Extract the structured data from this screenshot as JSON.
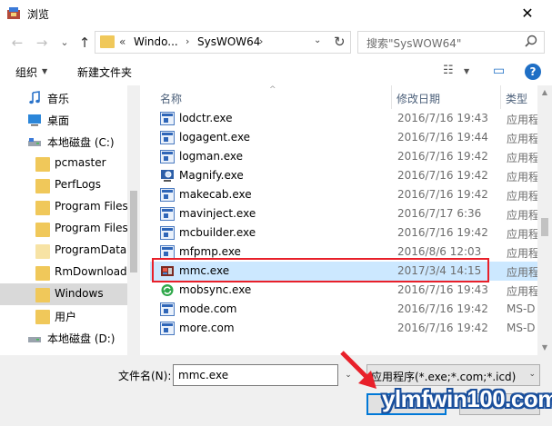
{
  "window": {
    "title": "浏览",
    "close_glyph": "✕"
  },
  "nav": {
    "back_glyph": "←",
    "forward_glyph": "→",
    "recent_glyph": "⌄",
    "up_glyph": "↑",
    "breadcrumb_overflow": "«",
    "breadcrumb": [
      "Windo...",
      "SysWOW64"
    ],
    "separator_glyph": "›",
    "dropdown_glyph": "⌄",
    "refresh_glyph": "↻",
    "search_placeholder": "搜索\"SysWOW64\""
  },
  "toolbar": {
    "organize_label": "组织",
    "organize_caret": "▼",
    "new_folder_label": "新建文件夹",
    "view_glyph": "☷",
    "view_caret": "▼",
    "preview_glyph": "▭",
    "help_glyph": "?"
  },
  "sidebar": {
    "items": [
      {
        "label": "音乐",
        "icon": "music-icon"
      },
      {
        "label": "桌面",
        "icon": "desktop-icon"
      },
      {
        "label": "本地磁盘 (C:)",
        "icon": "drive-icon"
      },
      {
        "label": "pcmaster",
        "icon": "folder-icon"
      },
      {
        "label": "PerfLogs",
        "icon": "folder-icon"
      },
      {
        "label": "Program Files",
        "icon": "folder-icon"
      },
      {
        "label": "Program Files",
        "icon": "folder-icon"
      },
      {
        "label": "ProgramData",
        "icon": "folder-icon"
      },
      {
        "label": "RmDownload",
        "icon": "folder-icon"
      },
      {
        "label": "Windows",
        "icon": "folder-icon",
        "selected": true
      },
      {
        "label": "用户",
        "icon": "folder-icon"
      },
      {
        "label": "本地磁盘 (D:)",
        "icon": "drive-icon"
      }
    ]
  },
  "columns": {
    "name": "名称",
    "modified": "修改日期",
    "type": "类型",
    "sort_glyph": "^"
  },
  "files": [
    {
      "name": "lodctr.exe",
      "modified": "2016/7/16 19:43",
      "type": "应用程",
      "icon": "exe-icon"
    },
    {
      "name": "logagent.exe",
      "modified": "2016/7/16 19:44",
      "type": "应用程",
      "icon": "exe-icon"
    },
    {
      "name": "logman.exe",
      "modified": "2016/7/16 19:42",
      "type": "应用程",
      "icon": "exe-icon"
    },
    {
      "name": "Magnify.exe",
      "modified": "2016/7/16 19:42",
      "type": "应用程",
      "icon": "magnifier-icon"
    },
    {
      "name": "makecab.exe",
      "modified": "2016/7/16 19:42",
      "type": "应用程",
      "icon": "exe-icon"
    },
    {
      "name": "mavinject.exe",
      "modified": "2016/7/17 6:36",
      "type": "应用程",
      "icon": "exe-icon"
    },
    {
      "name": "mcbuilder.exe",
      "modified": "2016/7/16 19:42",
      "type": "应用程",
      "icon": "exe-icon"
    },
    {
      "name": "mfpmp.exe",
      "modified": "2016/8/6 12:03",
      "type": "应用程",
      "icon": "exe-icon"
    },
    {
      "name": "mmc.exe",
      "modified": "2017/3/4 14:15",
      "type": "应用程",
      "icon": "mmc-icon",
      "selected": true
    },
    {
      "name": "mobsync.exe",
      "modified": "2016/7/16 19:43",
      "type": "应用程",
      "icon": "sync-icon"
    },
    {
      "name": "mode.com",
      "modified": "2016/7/16 19:42",
      "type": "MS-D",
      "icon": "exe-icon"
    },
    {
      "name": "more.com",
      "modified": "2016/7/16 19:42",
      "type": "MS-D",
      "icon": "exe-icon"
    }
  ],
  "bottom": {
    "filename_label": "文件名(N):",
    "filename_value": "mmc.exe",
    "filename_caret": "⌄",
    "filter_value": "应用程序(*.exe;*.com;*.icd)",
    "filter_caret": "⌄"
  },
  "watermark": "ylmfwin100.com",
  "colors": {
    "selection": "#cce8ff",
    "highlight_border": "#e8202a",
    "accent": "#0078d7"
  }
}
